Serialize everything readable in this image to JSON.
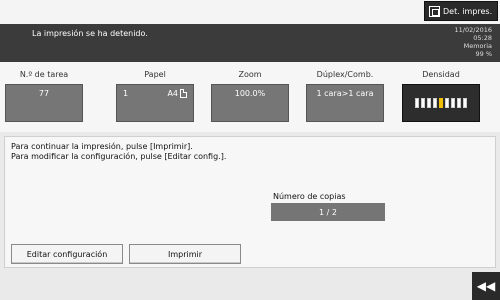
{
  "header": {
    "det_button_label": "Det. impres.",
    "det_button_icon": "print-details-icon"
  },
  "status": {
    "message": "La impresión se ha detenido.",
    "date": "11/02/2016",
    "time": "05:28",
    "memory_label": "Memoria",
    "memory_value": "99 %"
  },
  "params": {
    "job_number": {
      "label": "N.º de tarea",
      "value": "77"
    },
    "paper": {
      "label": "Papel",
      "tray": "1",
      "size": "A4",
      "icon": "portrait-page-icon"
    },
    "zoom": {
      "label": "Zoom",
      "value": "100.0%"
    },
    "duplex": {
      "label": "Dúplex/Comb.",
      "value": "1 cara>1 cara"
    },
    "density": {
      "label": "Densidad",
      "level": 4,
      "total": 9
    }
  },
  "main": {
    "line1": "Para continuar la impresión, pulse [Imprimir].",
    "line2": "Para modificar la configuración, pulse [Editar config.].",
    "copies_label": "Número de copias",
    "copies_value": "1  /  2",
    "edit_button": "Editar configuración",
    "print_button": "Imprimir"
  },
  "footer": {
    "fast_forward_icon": "fast-forward-icon",
    "fast_forward_glyph": "◀◀"
  },
  "colors": {
    "status_bar": "#3b3b3b",
    "density_accent": "#f0c000",
    "value_box": "#767676"
  }
}
